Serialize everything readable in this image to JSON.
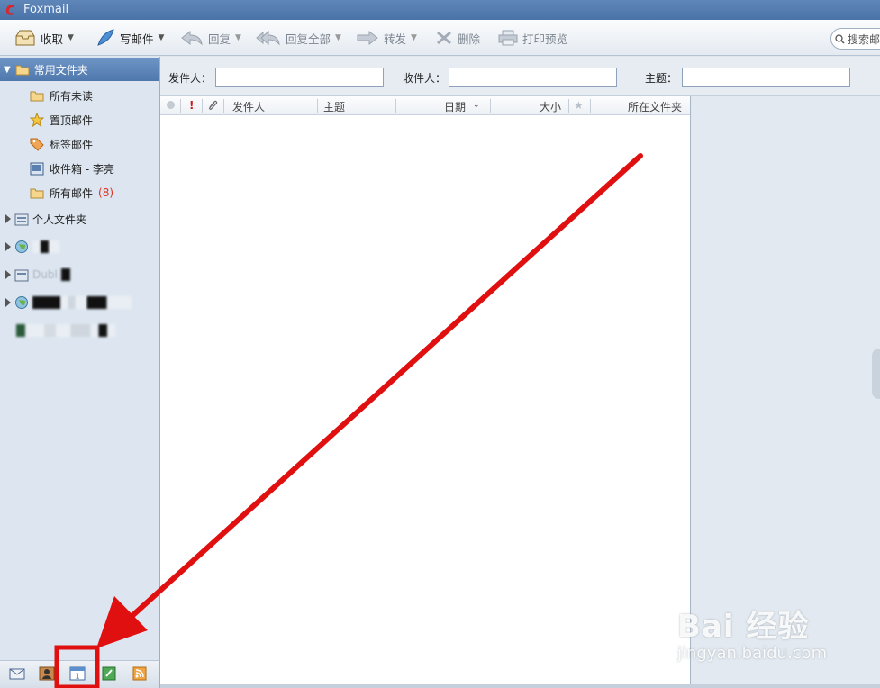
{
  "window": {
    "title": "Foxmail"
  },
  "toolbar": {
    "receive": "收取",
    "compose": "写邮件",
    "reply": "回复",
    "reply_all": "回复全部",
    "forward": "转发",
    "delete": "删除",
    "print_preview": "打印预览",
    "search_placeholder": "搜索邮"
  },
  "filter": {
    "from_label": "发件人：",
    "to_label": "收件人：",
    "subject_label": "主题："
  },
  "folders": {
    "favorites_header": "常用文件夹",
    "items": [
      {
        "label": "所有未读",
        "icon": "folder-icon"
      },
      {
        "label": "置顶邮件",
        "icon": "star-icon"
      },
      {
        "label": "标签邮件",
        "icon": "tag-icon"
      },
      {
        "label": "收件箱 - 李亮",
        "icon": "inbox-icon"
      },
      {
        "label": "所有邮件",
        "count": "(8)",
        "icon": "folder-icon"
      }
    ],
    "personal": "个人文件夹",
    "blurred_account_text": "Dubl"
  },
  "columns": {
    "from": "发件人",
    "subject": "主题",
    "date": "日期",
    "size": "大小",
    "folder": "所在文件夹"
  },
  "watermark": {
    "brand": "Bai 经验",
    "url": "jingyan.baidu.com"
  },
  "colors": {
    "title_bar": "#4a73a8",
    "folder_header": "#5a82b6",
    "annotation_red": "#e01010",
    "unread_count": "#dd3322"
  }
}
